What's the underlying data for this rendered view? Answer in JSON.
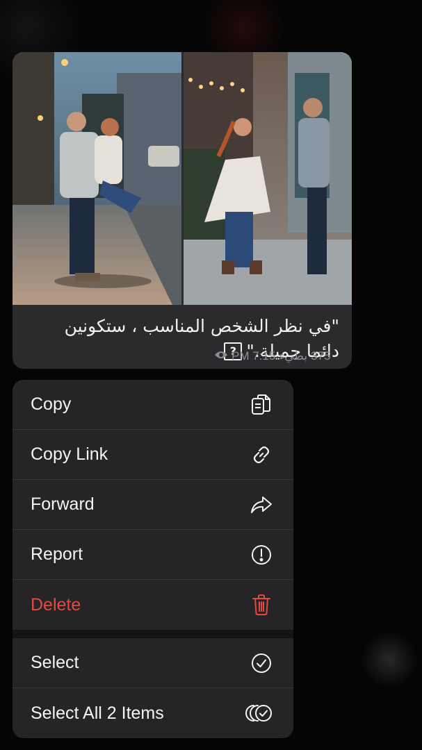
{
  "message": {
    "caption_line1": "\"في نظر الشخص المناسب ، ستكونين",
    "caption_line2": "دائما  جميلة.\"",
    "caption_emoji": "?",
    "views": "375",
    "author": "بطيء",
    "time": "PM 7:15",
    "photos": [
      {
        "name": "couple-street-hug-photo"
      },
      {
        "name": "couple-dancing-photo"
      }
    ]
  },
  "menu": {
    "items": [
      {
        "label": "Copy",
        "icon": "copy-icon"
      },
      {
        "label": "Copy Link",
        "icon": "link-icon"
      },
      {
        "label": "Forward",
        "icon": "forward-icon"
      },
      {
        "label": "Report",
        "icon": "report-icon"
      },
      {
        "label": "Delete",
        "icon": "trash-icon",
        "color": "#e5493f"
      },
      {
        "label": "Select",
        "icon": "checkmark-circle-icon"
      },
      {
        "label": "Select All 2 Items",
        "icon": "select-all-icon"
      }
    ]
  },
  "colors": {
    "background": "#050505",
    "bubble": "#2b2b2d",
    "menu": "#252527",
    "danger": "#e5493f",
    "meta_text": "#8d8d93"
  }
}
